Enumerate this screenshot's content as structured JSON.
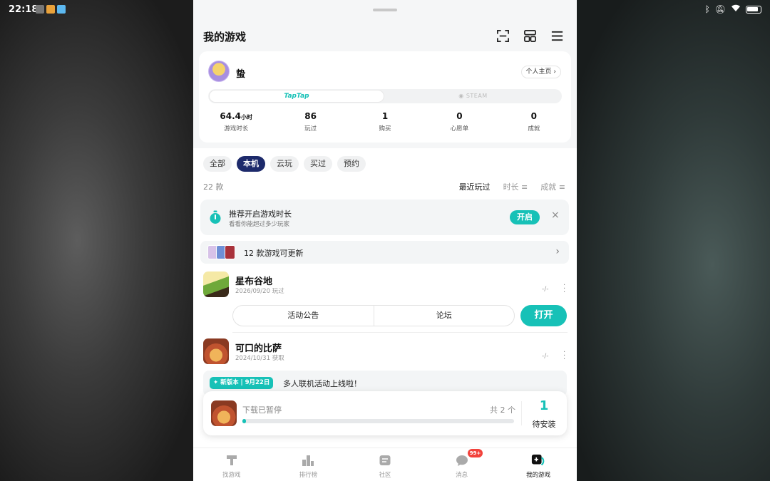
{
  "status_bar": {
    "time": "22:18"
  },
  "header": {
    "title": "我的游戏"
  },
  "profile": {
    "username": "蛰",
    "homepage_label": "个人主页 ›",
    "platforms": {
      "active": "TapTap",
      "other": "STEAM"
    },
    "stats": [
      {
        "value": "64.4",
        "unit": "小时",
        "label": "游戏时长"
      },
      {
        "value": "86",
        "unit": "",
        "label": "玩过"
      },
      {
        "value": "1",
        "unit": "",
        "label": "购买"
      },
      {
        "value": "0",
        "unit": "",
        "label": "心愿单"
      },
      {
        "value": "0",
        "unit": "",
        "label": "成就"
      }
    ]
  },
  "filters": [
    "全部",
    "本机",
    "云玩",
    "买过",
    "预约"
  ],
  "active_filter": "本机",
  "list": {
    "count": "22 款",
    "sort": [
      "最近玩过",
      "时长 ≡",
      "成就 ≡"
    ]
  },
  "banner": {
    "title": "推荐开启游戏时长",
    "subtitle": "看看你能超过多少玩家",
    "button": "开启",
    "close": "×"
  },
  "updates": {
    "text": "12 款游戏可更新",
    "arrow": "›"
  },
  "games": [
    {
      "name": "星布谷地",
      "sub": "2026/09/20 玩过",
      "dash": "-/-",
      "actions": [
        "活动公告",
        "论坛"
      ],
      "launch": "打开"
    },
    {
      "name": "可口的比萨",
      "sub": "2024/10/31 获取",
      "dash": "-/-"
    }
  ],
  "news": {
    "badge": "✦ 新版本 | 9月22日",
    "text": "多人联机活动上线啦！"
  },
  "download": {
    "status": "下载已暂停",
    "total": "共 2 个",
    "progress": 0.01,
    "pending_count": "1",
    "pending_label": "待安装"
  },
  "tabs": [
    {
      "label": "找游戏",
      "icon": "find-games-icon"
    },
    {
      "label": "排行榜",
      "icon": "ranking-icon"
    },
    {
      "label": "社区",
      "icon": "community-icon"
    },
    {
      "label": "消息",
      "icon": "message-icon",
      "badge": "99+"
    },
    {
      "label": "我的游戏",
      "icon": "my-games-icon"
    }
  ],
  "colors": {
    "accent": "#17c1b7",
    "active_chip": "#1d2a6b",
    "badge_red": "#f2423c"
  }
}
